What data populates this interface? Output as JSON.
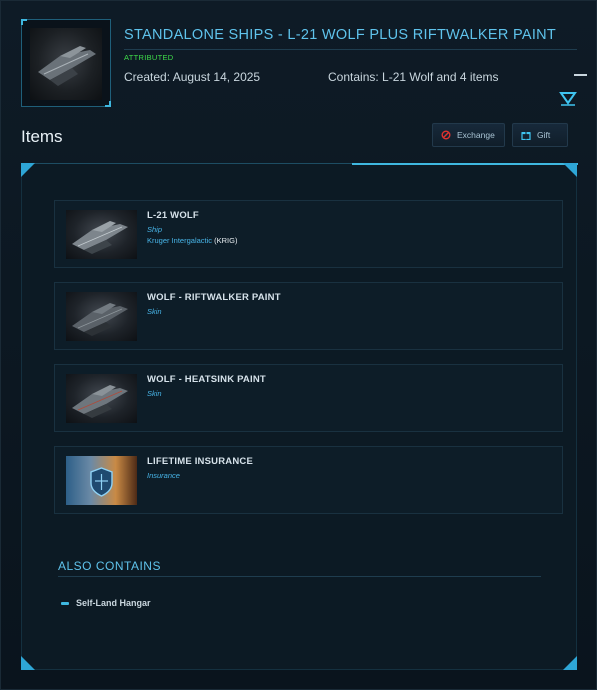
{
  "pledge": {
    "title": "STANDALONE SHIPS - L-21 WOLF PLUS RIFTWALKER PAINT",
    "status": "ATTRIBUTED",
    "created": "Created: August 14, 2025",
    "contains": "Contains: L-21 Wolf and 4 items",
    "icons": {
      "collapse": "minus-icon",
      "expand": "chevron-down-icon"
    }
  },
  "items_section": {
    "title": "Items",
    "actions": {
      "exchange_label": "Exchange",
      "gift_label": "Gift"
    },
    "action_icons": {
      "exchange": "exchange-icon",
      "gift": "gift-icon"
    },
    "list": [
      {
        "name": "L-21 WOLF",
        "type": "Ship",
        "manufacturer": "Kruger Intergalactic",
        "manufacturer_code": "(KRIG)",
        "image": "ship-image"
      },
      {
        "name": "WOLF - RIFTWALKER PAINT",
        "type": "Skin",
        "image": "ship-paint-image"
      },
      {
        "name": "WOLF - HEATSINK PAINT",
        "type": "Skin",
        "image": "ship-paint-image"
      },
      {
        "name": "LIFETIME INSURANCE",
        "type": "Insurance",
        "image": "insurance-image"
      }
    ]
  },
  "also_contains": {
    "title": "ALSO CONTAINS",
    "items": [
      "Self-Land Hangar"
    ]
  },
  "colors": {
    "accent": "#5fc3ec",
    "status_green": "#3fdc4a",
    "link_blue": "#48b5e8",
    "background": "#0b1620"
  }
}
